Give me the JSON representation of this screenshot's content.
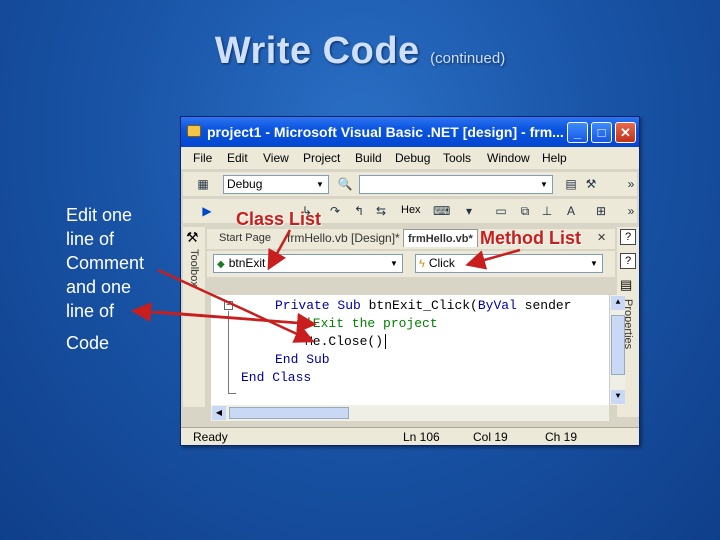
{
  "slide": {
    "title": "Write Code",
    "title_suffix": "(continued)",
    "left_text_lines": [
      "Edit one",
      "line of",
      "Comment",
      "and one",
      "line of"
    ],
    "left_text_last": "Code"
  },
  "window": {
    "title": "project1 - Microsoft Visual Basic .NET [design] - frm...",
    "minimize": "_",
    "maximize": "□",
    "close": "✕"
  },
  "menu": [
    "File",
    "Edit",
    "View",
    "Project",
    "Build",
    "Debug",
    "Tools",
    "Window",
    "Help"
  ],
  "toolbar": {
    "config_value": "Debug",
    "hex_label": "Hex",
    "overflow": "»"
  },
  "tabs": {
    "start_page": "Start Page",
    "design_tab": "frmHello.vb [Design]*",
    "code_tab": "frmHello.vb*",
    "close_glyph": "✕"
  },
  "side_panels": {
    "toolbox": "Toolbox",
    "properties": "Properties"
  },
  "code_editor": {
    "class_list_value": "btnExit",
    "method_list_value": "Click",
    "lines": [
      {
        "kw1": "Private Sub ",
        "text": "btnExit_Click(",
        "kw2": "ByVal",
        "rest": " sender"
      },
      {
        "comment": "'Exit the project"
      },
      {
        "text": "Me.Close()"
      },
      {
        "kw1": "End Sub"
      },
      {
        "kw1": "End Class"
      }
    ]
  },
  "status": {
    "ready": "Ready",
    "line": "Ln 106",
    "col": "Col 19",
    "ch": "Ch 19"
  },
  "annotations": {
    "class_list": "Class List",
    "method_list": "Method List"
  },
  "colors": {
    "background": "#1a55a8",
    "annotation": "#c81e1e",
    "keyword": "#00009f",
    "comment": "#008000",
    "titlebar": "#0a55e0"
  }
}
